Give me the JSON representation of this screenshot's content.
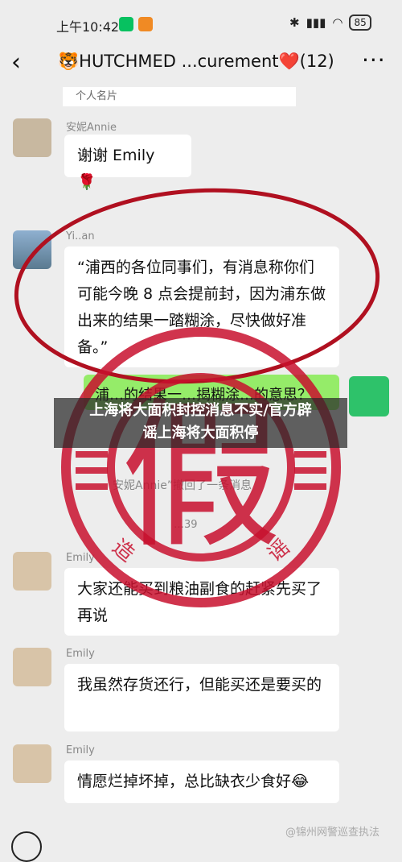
{
  "status": {
    "time": "上午10:42",
    "battery": "85"
  },
  "header": {
    "back_icon": "‹",
    "title": "🐯HUTCHMED ...curement❤️(12)",
    "more_icon": "···"
  },
  "chat": {
    "card_label": "个人名片",
    "messages": [
      {
        "sender": "安妮Annie",
        "text": "谢谢 Emily 🌹"
      },
      {
        "sender": "Yi..an",
        "text": "“浦西的各位同事们，有消息称你们可能今晚 8 点会提前封，因为浦东做出来的结果一踏糊涂，尽快做好准备。”"
      },
      {
        "sender": "Emily",
        "text": "大家还能买到粮油副食的赶紧先买了再说"
      },
      {
        "sender": "Emily",
        "text": "我虽然存货还行，但能买还是要买的"
      },
      {
        "sender": "Emily",
        "text": "情愿烂掉坏掉，总比缺衣少食好😂"
      }
    ],
    "green_fragment": "浦…的结果一…揭糊涂…的意思？",
    "system_note": "安妮Annie”撤回了一条消息",
    "timestamp": "…39"
  },
  "overlay": {
    "headline_line1": "上海将大面积封控消息不实/官方辟",
    "headline_line2": "谣上海将大面积停"
  },
  "stamp": {
    "big_char": "假",
    "arc_char_left": "造",
    "arc_char_right": "谣"
  },
  "watermark": "@锦州网警巡查执法",
  "colors": {
    "background": "#ededed",
    "bubble": "#ffffff",
    "self_bubble": "#95ec69",
    "stamp_red": "#c8102e",
    "circle_red": "#b01020"
  }
}
